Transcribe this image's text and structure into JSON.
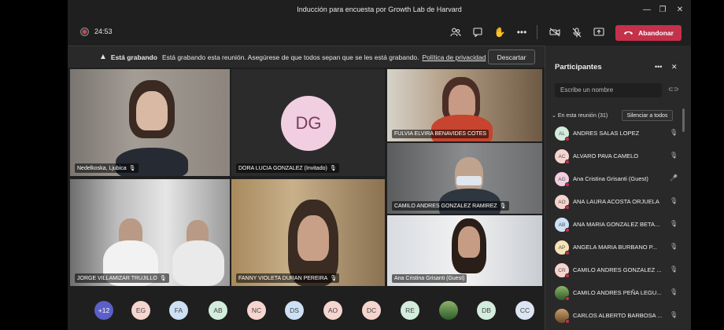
{
  "window": {
    "title": "Inducción para encuesta por Growth Lab de Harvard",
    "minimize": "—",
    "maximize": "❐",
    "close": "✕"
  },
  "toolbar": {
    "timer": "24:53",
    "leave_label": "Abandonar",
    "icons": [
      "participants-icon",
      "chat-icon",
      "raise-hand-icon",
      "more-icon",
      "camera-off-icon",
      "mic-off-icon",
      "share-screen-icon"
    ]
  },
  "banner": {
    "bold": "Está grabando",
    "message": "Está grabando esta reunión. Asegúrese de que todos sepan que se les está grabando.",
    "link": "Política de privacidad",
    "dismiss": "Descartar"
  },
  "tiles": [
    {
      "name": "Nedelkoska, Ljubica"
    },
    {
      "name": "DORA LUCIA GONZALEZ (Invitado)",
      "initials": "DG"
    },
    {
      "name": "FULVIA ELVIRA BENAVIDES COTES"
    },
    {
      "name": "CAMILO ANDRES GONZALEZ RAMIREZ"
    },
    {
      "name": "JORGE VILLAMIZAR TRUJILLO"
    },
    {
      "name": "FANNY VIOLETA DURAN PEREIRA"
    },
    {
      "name": "Ana Cristina Grisanti (Guest)"
    }
  ],
  "strip": [
    "+12",
    "EG",
    "FA",
    "AB",
    "NC",
    "DS",
    "AO",
    "DC",
    "RE",
    "",
    "DB",
    "CC"
  ],
  "panel": {
    "title": "Participantes",
    "search_placeholder": "Escribe un nombre",
    "section": "En esta reunión (31)",
    "mute_all": "Silenciar a todos",
    "participants": [
      {
        "initials": "AL",
        "name": "ANDRES SALAS LOPEZ"
      },
      {
        "initials": "AC",
        "name": "ALVARO PAVA CAMELO"
      },
      {
        "initials": "AG",
        "name": "Ana Cristina Grisanti (Guest)"
      },
      {
        "initials": "AO",
        "name": "ANA LAURA ACOSTA ORJUELA"
      },
      {
        "initials": "AB",
        "name": "ANA MARIA GONZALEZ BETA..."
      },
      {
        "initials": "AP",
        "name": "ANGELA MARIA BURBANO P..."
      },
      {
        "initials": "CR",
        "name": "CAMILO ANDRES GONZALEZ ..."
      },
      {
        "initials": "",
        "name": "CAMILO ANDRES PEÑA LEGU..."
      },
      {
        "initials": "",
        "name": "CARLOS ALBERTO BARBOSA ..."
      }
    ]
  },
  "colors": {
    "leave": "#c4314b",
    "recording": "#e0434e",
    "avatar_pink": "#f1cee0"
  }
}
